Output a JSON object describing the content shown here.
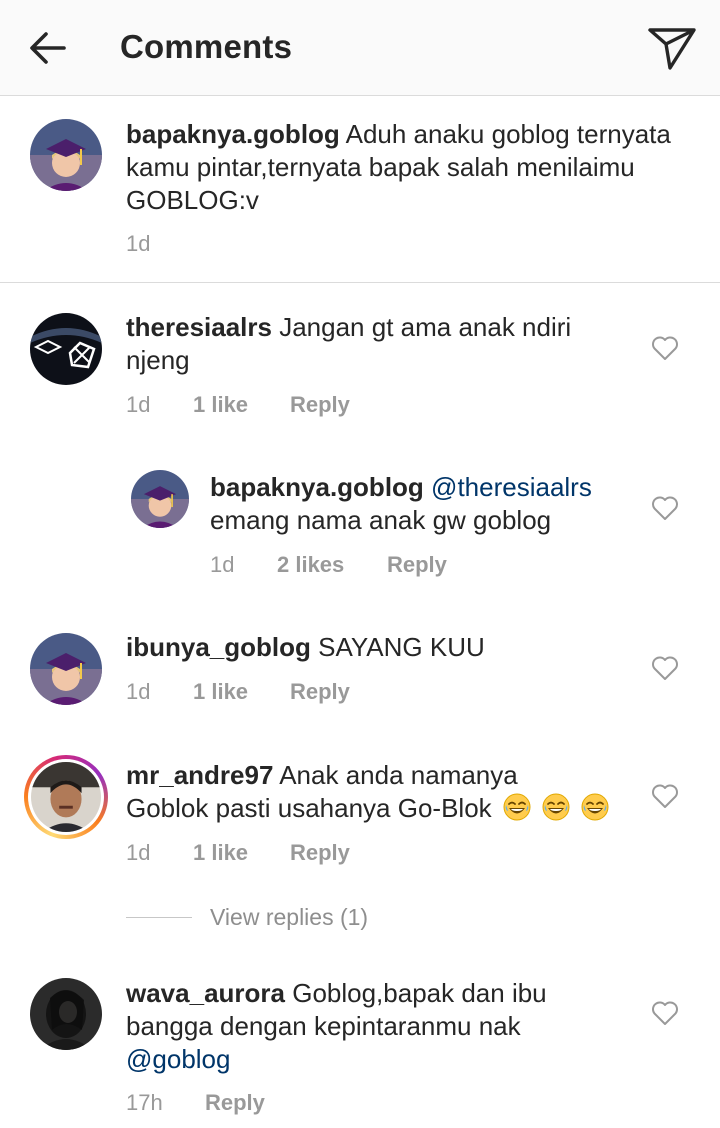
{
  "header": {
    "title": "Comments",
    "back_icon": "arrow-left-icon",
    "send_icon": "paper-plane-icon"
  },
  "caption": {
    "username": "bapaknya.goblog",
    "text": "Aduh anaku goblog ternyata kamu pintar,ternyata bapak salah menilaimu GOBLOG:v",
    "time": "1d"
  },
  "comments": [
    {
      "username": "theresiaalrs",
      "text_line1": "Jangan gt ama anak ndiri",
      "text_line2": "njeng",
      "time": "1d",
      "likes": "1 like",
      "reply": "Reply"
    },
    {
      "username": "bapaknya.goblog",
      "mention": "@theresiaalrs",
      "text_line2": "emang nama anak gw goblog",
      "time": "1d",
      "likes": "2 likes",
      "reply": "Reply"
    },
    {
      "username": "ibunya_goblog",
      "text_line1": "SAYANG KUU",
      "time": "1d",
      "likes": "1 like",
      "reply": "Reply"
    },
    {
      "username": "mr_andre97",
      "text_line1": "Anak anda namanya",
      "text_line2": "Goblok pasti usahanya Go-Blok",
      "time": "1d",
      "likes": "1 like",
      "reply": "Reply",
      "view_replies": "View replies (1)"
    },
    {
      "username": "wava_aurora",
      "text_line1": "Goblog,bapak dan ibu",
      "text_line2": "bangga dengan kepintaranmu nak",
      "mention": "@goblog",
      "time": "17h",
      "reply": "Reply"
    }
  ],
  "colors": {
    "text": "#262626",
    "meta": "#999999",
    "mention": "#003569",
    "header_bg": "#fafafa"
  }
}
